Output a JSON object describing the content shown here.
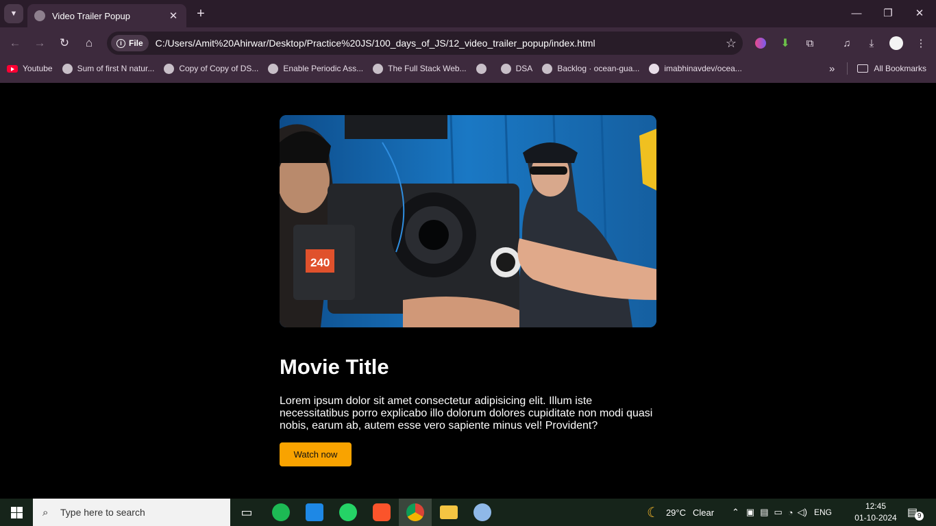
{
  "browser": {
    "tab_title": "Video Trailer Popup",
    "url_chip": "File",
    "url": "C:/Users/Amit%20Ahirwar/Desktop/Practice%20JS/100_days_of_JS/12_video_trailer_popup/index.html",
    "bookmarks": [
      {
        "label": "Youtube",
        "icon": "youtube-icon"
      },
      {
        "label": "Sum of first N natur...",
        "icon": "globe-icon"
      },
      {
        "label": "Copy of Copy of DS...",
        "icon": "globe-icon"
      },
      {
        "label": "Enable Periodic Ass...",
        "icon": "globe-icon"
      },
      {
        "label": "The Full Stack Web...",
        "icon": "globe-icon"
      },
      {
        "label": "",
        "icon": "globe-icon"
      },
      {
        "label": "DSA",
        "icon": "globe-icon"
      },
      {
        "label": "Backlog · ocean-gua...",
        "icon": "globe-icon"
      },
      {
        "label": "imabhinavdev/ocea...",
        "icon": "github-icon"
      }
    ],
    "all_bookmarks": "All Bookmarks"
  },
  "page": {
    "movie_title": "Movie Title",
    "description": "Lorem ipsum dolor sit amet consectetur adipisicing elit. Illum iste necessitatibus porro explicabo illo dolorum dolores cupiditate non modi quasi nobis, earum ab, autem esse vero sapiente minus vel! Provident?",
    "watch_button": "Watch now",
    "accent_color": "#f9a300"
  },
  "taskbar": {
    "search_placeholder": "Type here to search",
    "weather_temp": "29°C",
    "weather_text": "Clear",
    "language": "ENG",
    "time": "12:45",
    "date": "01-10-2024",
    "notification_count": "9"
  }
}
